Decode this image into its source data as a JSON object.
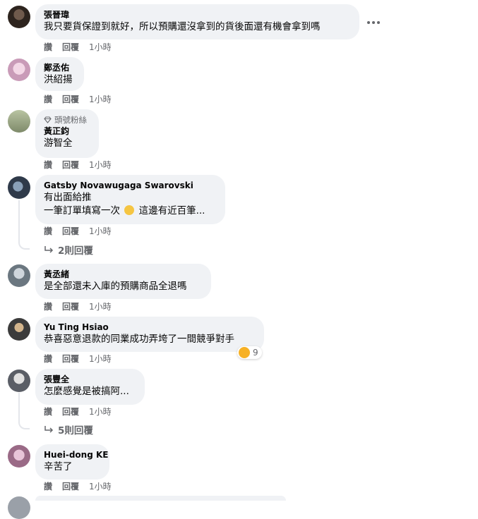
{
  "comments": [
    {
      "author": "張晉瑋",
      "lines": [
        "我只要貨保證到就好，所以預購還沒拿到的貨後面還有機會拿到嗎"
      ],
      "actions": {
        "like": "讚",
        "reply": "回覆",
        "time": "1小時"
      }
    },
    {
      "author": "鄭丞佑",
      "lines": [
        "洪紹揚"
      ],
      "actions": {
        "like": "讚",
        "reply": "回覆",
        "time": "1小時"
      }
    },
    {
      "badge": "頭號粉絲",
      "author": "黃正鈞",
      "lines": [
        "游智全"
      ],
      "actions": {
        "like": "讚",
        "reply": "回覆",
        "time": "1小時"
      }
    },
    {
      "author": "Gatsby Novawugaga Swarovski",
      "lines": [
        "有出面給推",
        "一筆訂單填寫一次",
        "這邊有近百筆..."
      ],
      "actions": {
        "like": "讚",
        "reply": "回覆",
        "time": "1小時"
      },
      "replies": "2則回覆"
    },
    {
      "author": "黃丞緒",
      "lines": [
        "是全部還未入庫的預購商品全退嗎"
      ],
      "actions": {
        "like": "讚",
        "reply": "回覆",
        "time": "1小時"
      }
    },
    {
      "author": "Yu Ting Hsiao",
      "lines": [
        "恭喜惡意退款的同業成功弄垮了一間競爭對手"
      ],
      "actions": {
        "like": "讚",
        "reply": "回覆",
        "time": "1小時"
      },
      "reaction_count": "9"
    },
    {
      "author": "張豐全",
      "lines": [
        "怎麼感覺是被搞阿..."
      ],
      "actions": {
        "like": "讚",
        "reply": "回覆",
        "time": "1小時"
      },
      "replies": "5則回覆"
    },
    {
      "author": "Huei-dong KE",
      "lines": [
        "辛苦了"
      ],
      "actions": {
        "like": "讚",
        "reply": "回覆",
        "time": "1小時"
      }
    }
  ],
  "colors": {
    "bubble": "#f0f2f5",
    "meta": "#65676b",
    "text": "#050505"
  },
  "icons": {
    "more": "more-horizontal-icon",
    "badge": "diamond-icon",
    "replies": "reply-arrow-icon",
    "reaction": "sad-emoji-icon"
  }
}
